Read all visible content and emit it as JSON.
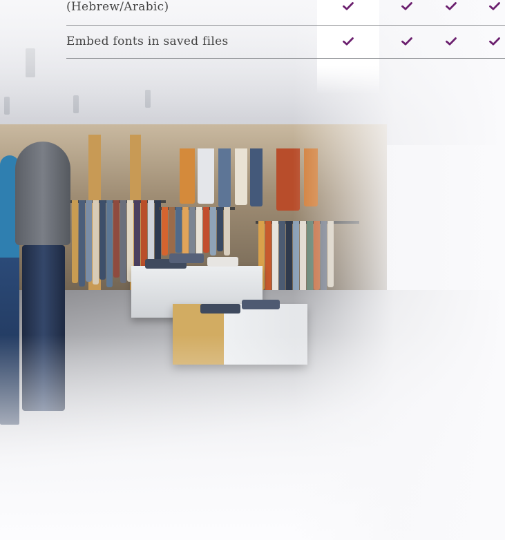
{
  "table": {
    "rows": [
      {
        "label": "(Hebrew/Arabic)",
        "checks": [
          true,
          true,
          true,
          true
        ]
      },
      {
        "label": "Embed fonts in saved files",
        "checks": [
          true,
          true,
          true,
          true
        ]
      }
    ]
  },
  "colors": {
    "check": "#6b1f6e",
    "rule": "#8a8c90",
    "text": "#444444"
  },
  "icons": {
    "check": "checkmark-icon"
  }
}
